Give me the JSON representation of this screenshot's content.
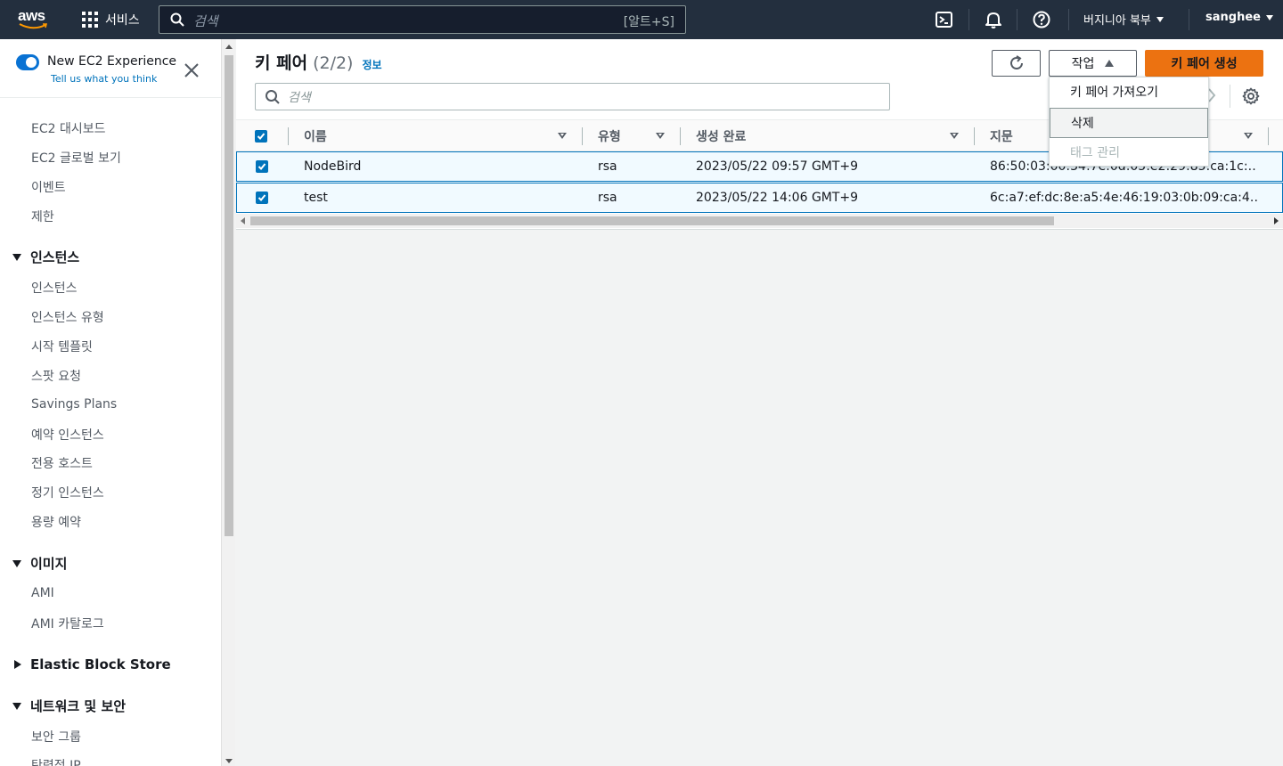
{
  "topnav": {
    "logo_text": "aws",
    "services_label": "서비스",
    "search_placeholder": "검색",
    "search_shortcut": "[알트+S]",
    "region_label": "버지니아 북부",
    "user_label": "sanghee"
  },
  "sidebar": {
    "experience_title": "New EC2 Experience",
    "experience_link": "Tell us what you think",
    "top_items": [
      "EC2 대시보드",
      "EC2 글로벌 보기",
      "이벤트",
      "제한"
    ],
    "sections": [
      {
        "label": "인스턴스",
        "expanded": true,
        "items": [
          "인스턴스",
          "인스턴스 유형",
          "시작 템플릿",
          "스팟 요청",
          "Savings Plans",
          "예약 인스턴스",
          "전용 호스트",
          "정기 인스턴스",
          "용량 예약"
        ]
      },
      {
        "label": "이미지",
        "expanded": true,
        "items": [
          "AMI",
          "AMI 카탈로그"
        ]
      },
      {
        "label": "Elastic Block Store",
        "expanded": false,
        "items": []
      },
      {
        "label": "네트워크 및 보안",
        "expanded": true,
        "items": [
          "보안 그룹",
          "탄력적 IP"
        ]
      }
    ]
  },
  "main": {
    "title": "키 페어",
    "count": "(2/2)",
    "info_link": "정보",
    "search_placeholder": "검색",
    "actions_label": "작업",
    "create_label": "키 페어 생성",
    "create_color": "#ec7211",
    "actions_menu": [
      "키 페어 가져오기",
      "삭제",
      "태그 관리"
    ],
    "columns": [
      "이름",
      "유형",
      "생성 완료",
      "지문"
    ],
    "rows": [
      {
        "name": "NodeBird",
        "type": "rsa",
        "created": "2023/05/22 09:57 GMT+9",
        "fingerprint": "86:50:03:00:34:7e:0d:05:e2:29:85:ca:1c:…",
        "selected": true
      },
      {
        "name": "test",
        "type": "rsa",
        "created": "2023/05/22 14:06 GMT+9",
        "fingerprint": "6c:a7:ef:dc:8e:a5:4e:46:19:03:0b:09:ca:4…",
        "selected": true
      }
    ]
  }
}
